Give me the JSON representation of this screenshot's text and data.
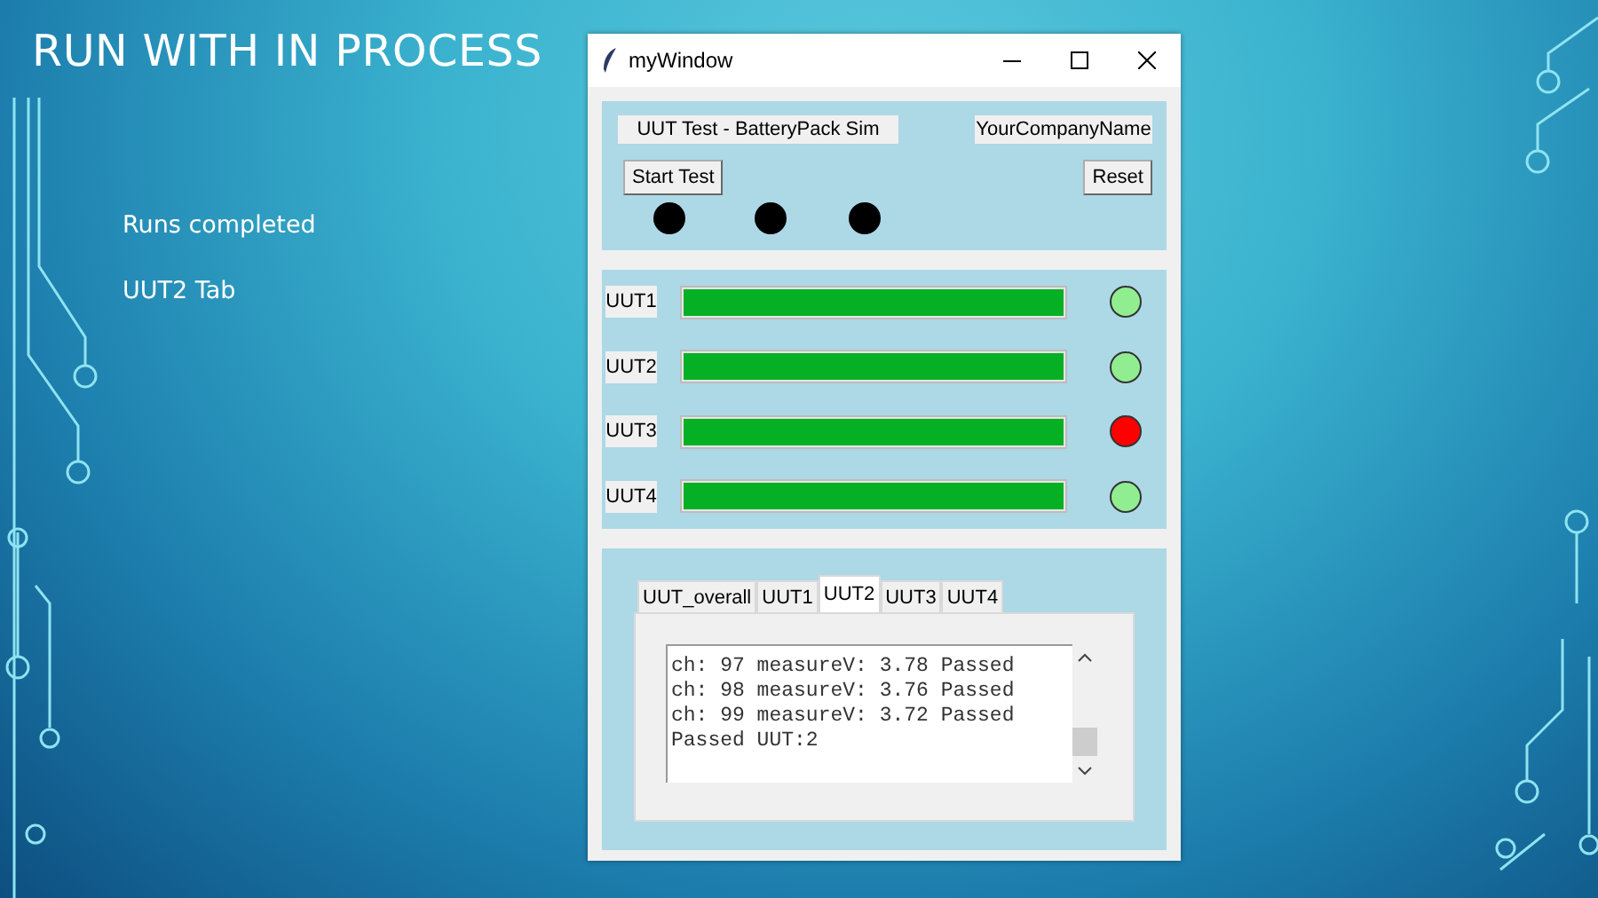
{
  "slide": {
    "title": "RUN WITH IN PROCESS",
    "bullets": [
      "Runs completed",
      "UUT2 Tab"
    ]
  },
  "window": {
    "title": "myWindow",
    "header_label": "UUT Test - BatteryPack Sim",
    "company_label": "YourCompanyName",
    "buttons": [
      "Start Test",
      "Reset"
    ],
    "indicators": [
      {
        "color": "#000000"
      },
      {
        "color": "#000000"
      },
      {
        "color": "#000000"
      }
    ],
    "uuts": [
      {
        "label": "UUT1",
        "level": 1,
        "color": "#90ee90"
      },
      {
        "label": "UUT2",
        "level": 1,
        "color": "#90ee90"
      },
      {
        "label": "UUT3",
        "level": 1,
        "color": "#ff0000"
      },
      {
        "label": "UUT4",
        "level": 1,
        "color": "#90ee90"
      }
    ],
    "tabs": [
      {
        "label": "UUT_overall",
        "selected": false
      },
      {
        "label": "UUT1",
        "selected": false
      },
      {
        "label": "UUT2",
        "selected": true
      },
      {
        "label": "UUT3",
        "selected": false
      },
      {
        "label": "UUT4",
        "selected": false
      }
    ],
    "log_lines": [
      "ch: 97 measureV: 3.78 Passed",
      "ch: 98 measureV: 3.76 Passed",
      "ch: 99 measureV: 3.72 Passed",
      "Passed UUT:2"
    ]
  }
}
